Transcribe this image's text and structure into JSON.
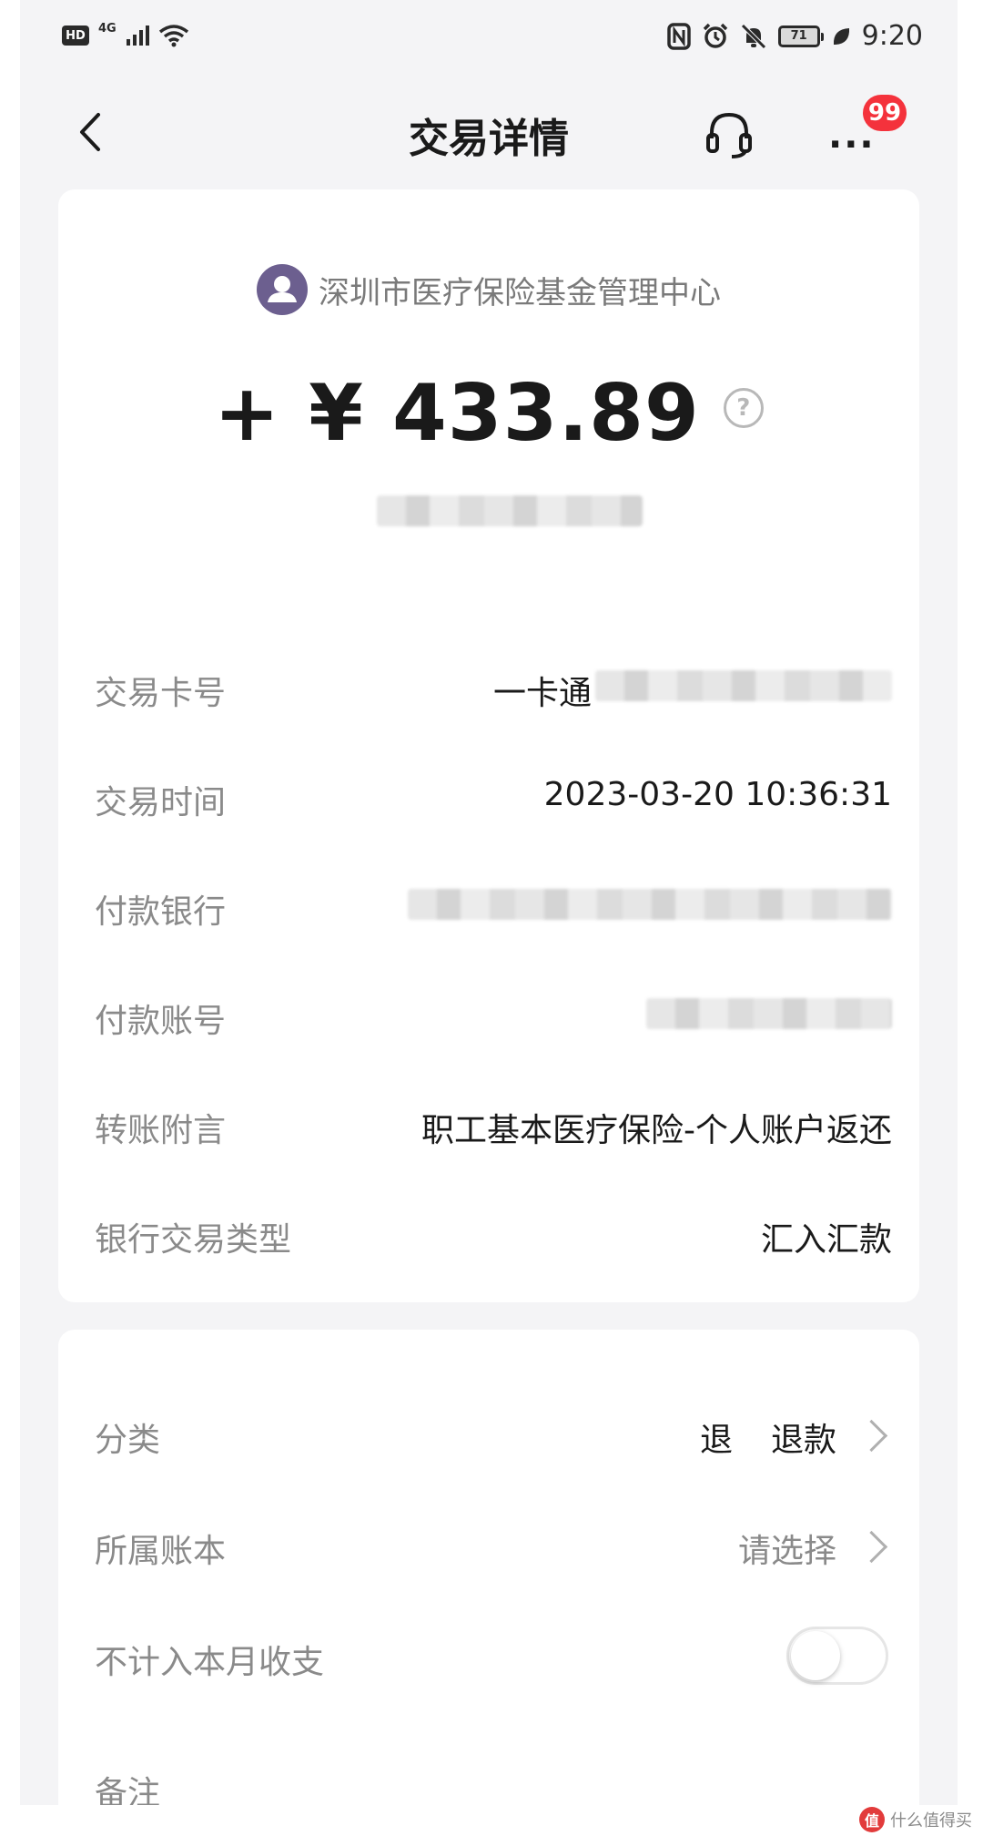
{
  "status_bar": {
    "hd": "HD",
    "network": "4G",
    "battery": "71",
    "time": "9:20"
  },
  "nav": {
    "title": "交易详情",
    "more_label": "···",
    "notification_count": "99"
  },
  "transaction": {
    "merchant": "深圳市医疗保险基金管理中心",
    "amount": "+ ¥ 433.89",
    "help_label": "?"
  },
  "details": [
    {
      "label": "交易卡号",
      "value": "一卡通"
    },
    {
      "label": "交易时间",
      "value": "2023-03-20 10:36:31"
    },
    {
      "label": "付款银行",
      "value": ""
    },
    {
      "label": "付款账号",
      "value": ""
    },
    {
      "label": "转账附言",
      "value": "职工基本医疗保险-个人账户返还"
    },
    {
      "label": "银行交易类型",
      "value": "汇入汇款"
    }
  ],
  "settings": {
    "category_label": "分类",
    "category_tag": "退",
    "category_value": "退款",
    "book_label": "所属账本",
    "book_value": "请选择",
    "exclude_label": "不计入本月收支",
    "exclude_on": false,
    "note_label": "备注"
  },
  "watermark": {
    "logo": "值",
    "text": "什么值得买"
  },
  "colors": {
    "badge": "#f4323c",
    "avatar": "#6c5f8f",
    "background": "#f4f4f6"
  },
  "icons": [
    "back-arrow-icon",
    "headset-icon",
    "more-icon",
    "help-icon",
    "chevron-right-icon"
  ]
}
